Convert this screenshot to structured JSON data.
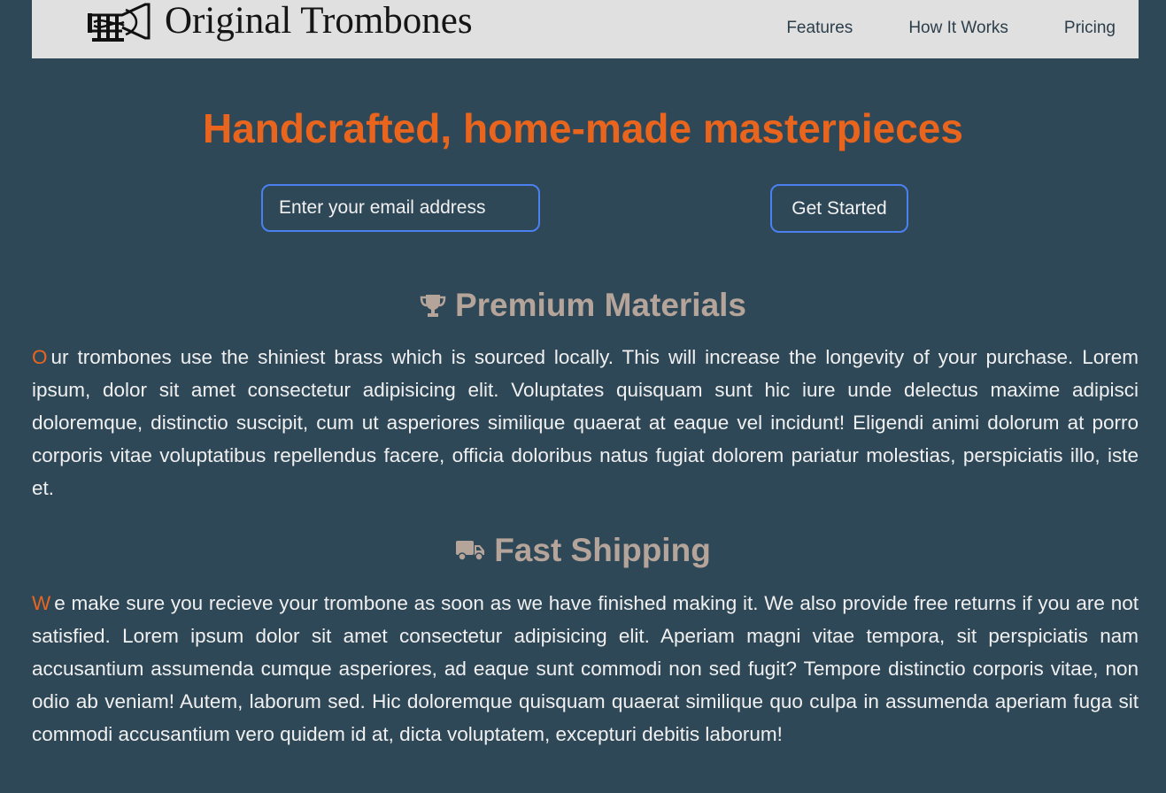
{
  "header": {
    "brand": "Original Trombones",
    "logo_icon": "trombone-logo-icon",
    "nav": [
      {
        "label": "Features"
      },
      {
        "label": "How It Works"
      },
      {
        "label": "Pricing"
      }
    ]
  },
  "hero": {
    "title": "Handcrafted, home-made masterpieces",
    "email_placeholder": "Enter your email address",
    "cta_label": "Get Started"
  },
  "features": [
    {
      "icon": "trophy-icon",
      "title": "Premium Materials",
      "first_letter": "O",
      "text": "ur trombones use the shiniest brass which is sourced locally. This will increase the longevity of your purchase. Lorem ipsum, dolor sit amet consectetur adipisicing elit. Voluptates quisquam sunt hic iure unde delectus maxime adipisci doloremque, distinctio suscipit, cum ut asperiores similique quaerat at eaque vel incidunt! Eligendi animi dolorum at porro corporis vitae voluptatibus repellendus facere, officia doloribus natus fugiat dolorem pariatur molestias, perspiciatis illo, iste et."
    },
    {
      "icon": "truck-icon",
      "title": "Fast Shipping",
      "first_letter": "W",
      "text": "e make sure you recieve your trombone as soon as we have finished making it. We also provide free returns if you are not satisfied. Lorem ipsum dolor sit amet consectetur adipisicing elit. Aperiam magni vitae tempora, sit perspiciatis nam accusantium assumenda cumque asperiores, ad eaque sunt commodi non sed fugit? Tempore distinctio corporis vitae, non odio ab veniam! Autem, laborum sed. Hic doloremque quisquam quaerat similique quo culpa in assumenda aperiam fuga sit commodi accusantium vero quidem id at, dicta voluptatem, excepturi debitis laborum!"
    }
  ],
  "colors": {
    "background": "#2f4858",
    "header_bg": "#e0e0e0",
    "accent": "#e9651e",
    "section_title": "#b5a49a",
    "input_border": "#4a80f0"
  }
}
